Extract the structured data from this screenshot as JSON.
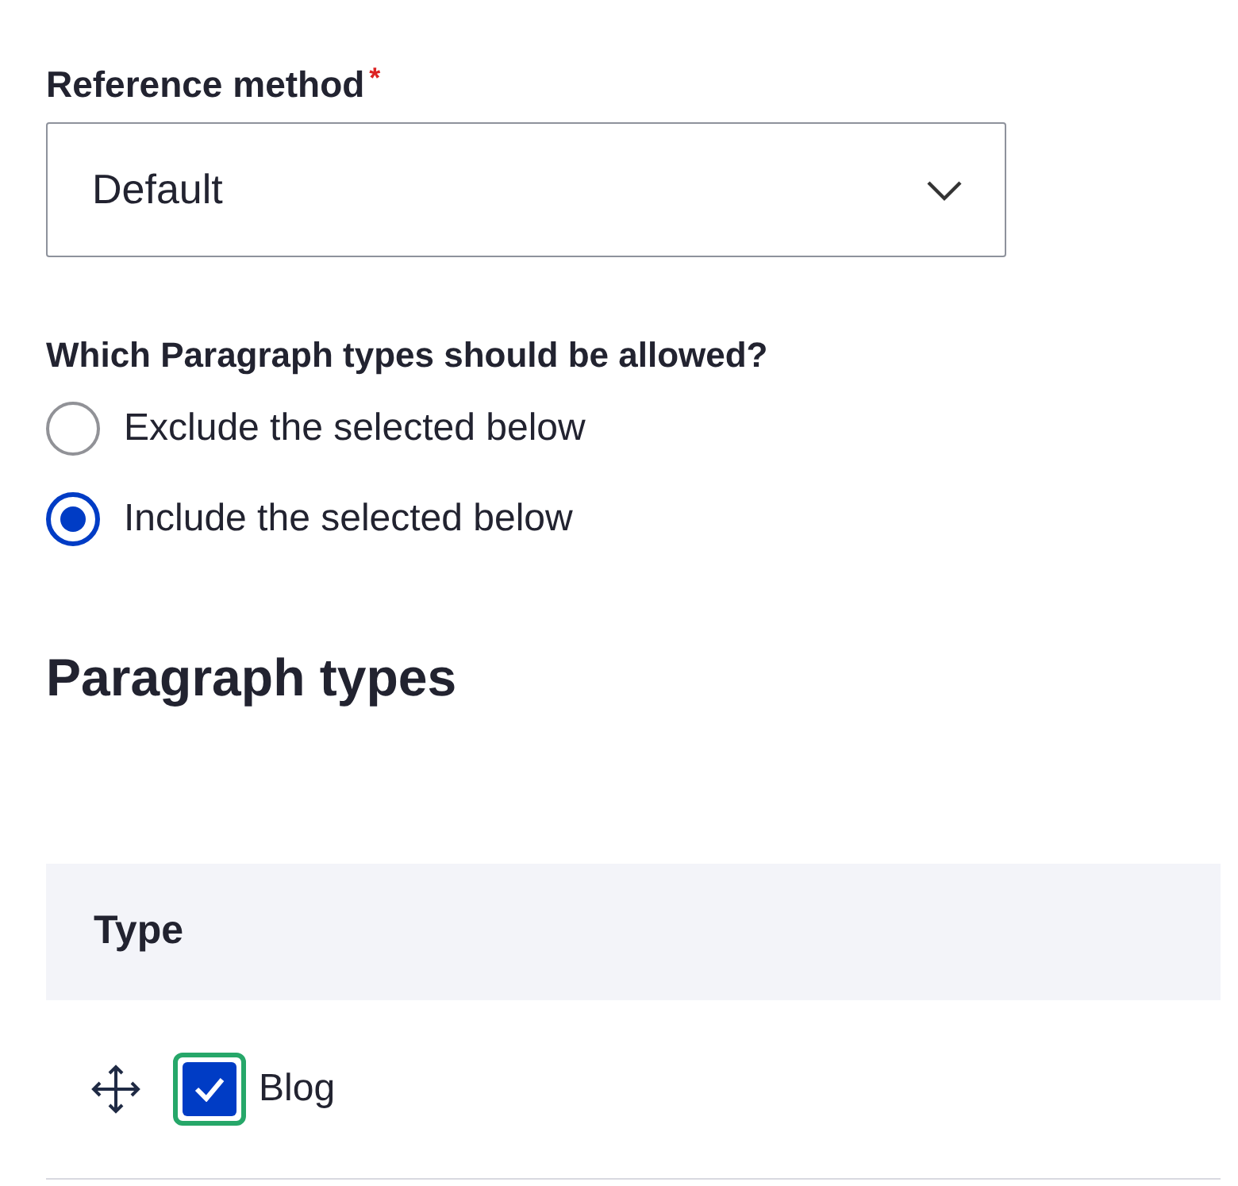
{
  "reference_method": {
    "label": "Reference method",
    "required_mark": "*",
    "value": "Default"
  },
  "allowed": {
    "question": "Which Paragraph types should be allowed?",
    "options": [
      {
        "label": "Exclude the selected below",
        "selected": false
      },
      {
        "label": "Include the selected below",
        "selected": true
      }
    ]
  },
  "section_heading": "Paragraph types",
  "table": {
    "columns": [
      "Type"
    ],
    "rows": [
      {
        "label": "Blog",
        "checked": true,
        "focused": true
      }
    ]
  }
}
